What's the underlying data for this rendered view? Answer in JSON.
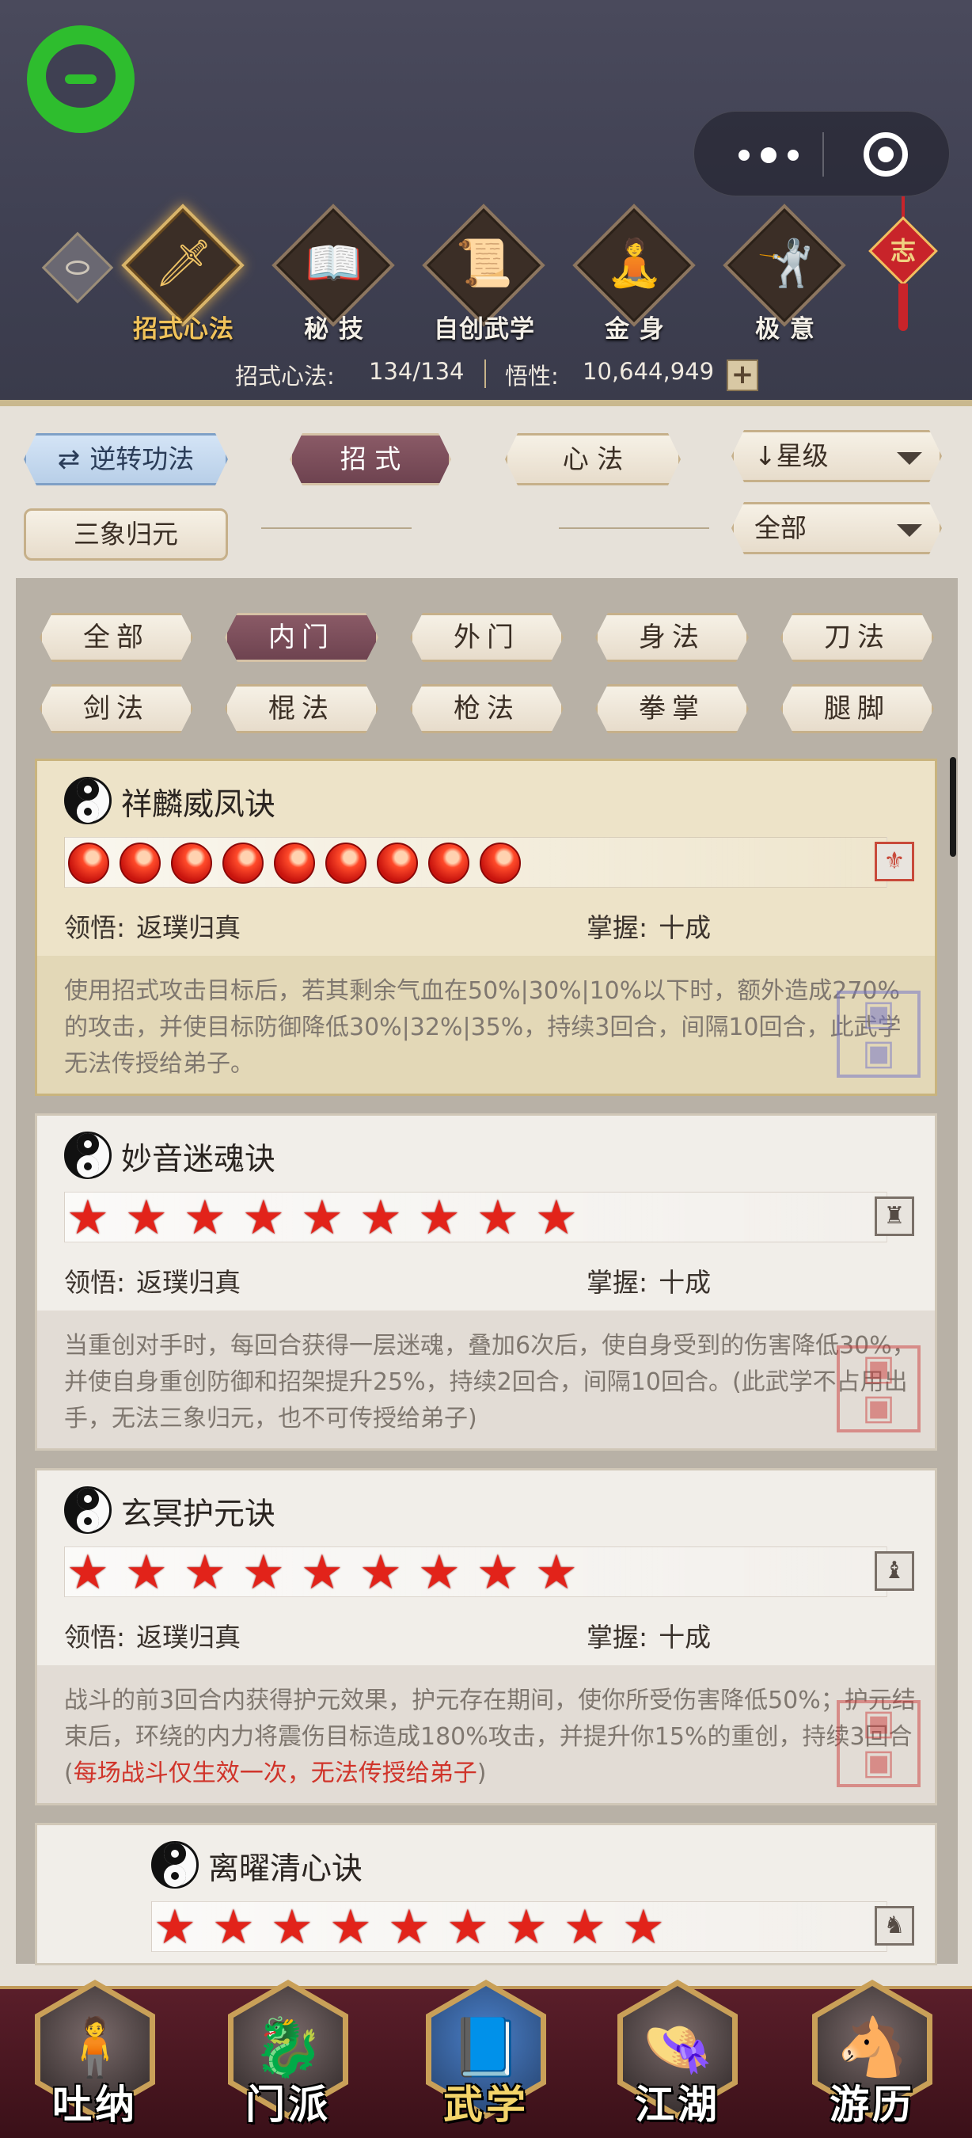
{
  "header": {
    "nav_tabs": [
      {
        "label": "招式心法",
        "icon": "sword-icon",
        "glyph": "🗡",
        "active": true
      },
      {
        "label": "秘 技",
        "icon": "book-icon",
        "glyph": "📖",
        "active": false
      },
      {
        "label": "自创武学",
        "icon": "scroll-icon",
        "glyph": "📜",
        "active": false
      },
      {
        "label": "金 身",
        "icon": "meditation-icon",
        "glyph": "🧘",
        "active": false
      },
      {
        "label": "极 意",
        "icon": "martial-stance-icon",
        "glyph": "🤺",
        "active": false
      }
    ],
    "knot_char": "志",
    "stats": {
      "skills_label": "招式心法:",
      "skills_value": "134/134",
      "insight_label": "悟性:",
      "insight_value": "10,644,949"
    }
  },
  "filters": {
    "reverse_label": "逆转功法",
    "tab_moves": "招 式",
    "tab_mental": "心 法",
    "sort_label": "星级",
    "sanxiang_label": "三象归元",
    "scope_label": "全部"
  },
  "categories": [
    "全部",
    "内门",
    "外门",
    "身法",
    "刀法",
    "剑法",
    "棍法",
    "枪法",
    "拳掌",
    "腿脚"
  ],
  "active_category": "内门",
  "skills": [
    {
      "name": "祥麟威凤诀",
      "stars": 9,
      "star_kind": "flame",
      "comprehension_label": "领悟:",
      "comprehension_value": "返璞归真",
      "mastery_label": "掌握:",
      "mastery_value": "十成",
      "desc": "使用招式攻击目标后，若其剩余气血在50%|30%|10%以下时，额外造成270%的攻击，并使目标防御降低30%|32%|35%，持续3回合，间隔10回合，此武学无法传授给弟子。",
      "desc_highlight": ""
    },
    {
      "name": "妙音迷魂诀",
      "stars": 9,
      "star_kind": "star",
      "comprehension_label": "领悟:",
      "comprehension_value": "返璞归真",
      "mastery_label": "掌握:",
      "mastery_value": "十成",
      "desc": "当重创对手时，每回合获得一层迷魂，叠加6次后，使自身受到的伤害降低30%，并使自身重创防御和招架提升25%，持续2回合，间隔10回合。(此武学不占用出手，无法三象归元，也不可传授给弟子)",
      "desc_highlight": ""
    },
    {
      "name": "玄冥护元诀",
      "stars": 9,
      "star_kind": "star",
      "comprehension_label": "领悟:",
      "comprehension_value": "返璞归真",
      "mastery_label": "掌握:",
      "mastery_value": "十成",
      "desc": "战斗的前3回合内获得护元效果，护元存在期间，使你所受伤害降低50%；护元结束后，环绕的内力将震伤目标造成180%攻击，并提升你15%的重创，持续3回合(",
      "desc_highlight": "每场战斗仅生效一次，无法传授给弟子",
      "desc_tail": ")"
    },
    {
      "name": "离曜清心诀",
      "stars": 9,
      "star_kind": "star"
    }
  ],
  "bottom_nav": [
    {
      "label": "吐纳",
      "icon": "breathing-figure-icon",
      "glyph": "🧍",
      "active": false
    },
    {
      "label": "门派",
      "icon": "sect-dragon-icon",
      "glyph": "🐉",
      "active": false
    },
    {
      "label": "武学",
      "icon": "manual-book-icon",
      "glyph": "📘",
      "active": true
    },
    {
      "label": "江湖",
      "icon": "bamboo-hat-icon",
      "glyph": "👒",
      "active": false
    },
    {
      "label": "游历",
      "icon": "horse-icon",
      "glyph": "🐴",
      "active": false
    }
  ]
}
